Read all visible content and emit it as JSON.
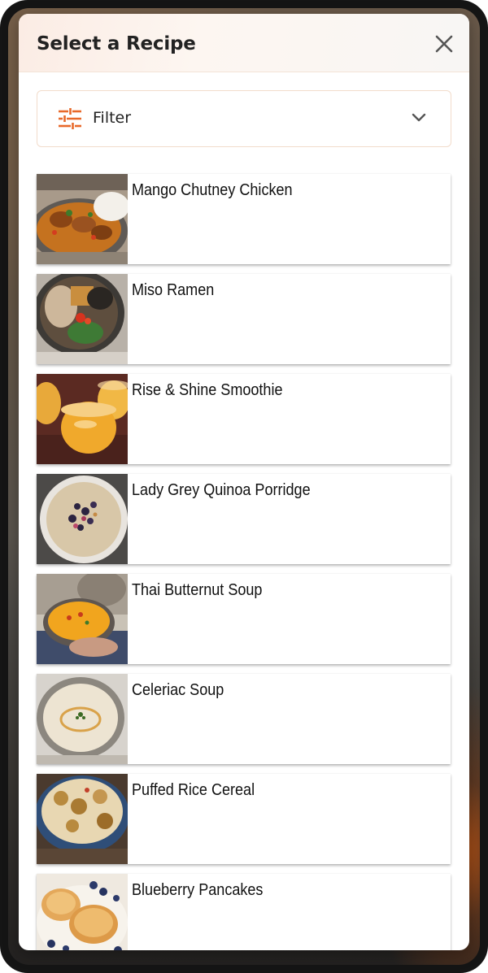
{
  "modal": {
    "title": "Select a Recipe"
  },
  "filter": {
    "label": "Filter"
  },
  "colors": {
    "accent": "#e8692a",
    "title_text": "#222222",
    "filter_border": "#f2dccb"
  },
  "icons": {
    "close": "close-icon",
    "filter": "sliders-icon",
    "expand": "chevron-down-icon"
  },
  "recipes": [
    {
      "name": "Mango Chutney Chicken"
    },
    {
      "name": "Miso Ramen"
    },
    {
      "name": "Rise & Shine Smoothie"
    },
    {
      "name": "Lady Grey Quinoa Porridge"
    },
    {
      "name": "Thai Butternut Soup"
    },
    {
      "name": "Celeriac Soup"
    },
    {
      "name": "Puffed Rice Cereal"
    },
    {
      "name": "Blueberry Pancakes"
    }
  ]
}
